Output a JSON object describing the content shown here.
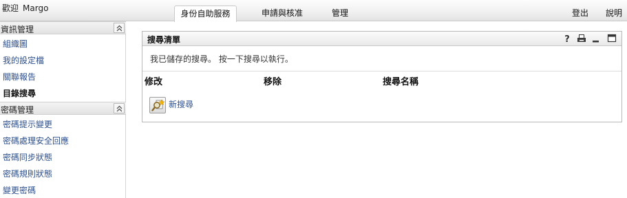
{
  "header": {
    "welcome_label": "歡迎",
    "user_name": "Margo",
    "tabs": [
      {
        "label": "身份自助服務",
        "active": true
      },
      {
        "label": "申請與核准",
        "active": false
      },
      {
        "label": "管理",
        "active": false
      }
    ],
    "logout_label": "登出",
    "help_label": "說明"
  },
  "sidebar": {
    "sections": [
      {
        "title": "資訊管理",
        "items": [
          {
            "label": "組織圖"
          },
          {
            "label": "我的設定檔"
          },
          {
            "label": "關聯報告"
          },
          {
            "label": "目錄搜尋",
            "current": true
          }
        ]
      },
      {
        "title": "密碼管理",
        "items": [
          {
            "label": "密碼提示變更"
          },
          {
            "label": "密碼處理安全回應"
          },
          {
            "label": "密碼同步狀態"
          },
          {
            "label": "密碼規則狀態"
          },
          {
            "label": "變更密碼"
          }
        ]
      }
    ]
  },
  "panel": {
    "title": "搜尋清單",
    "description": "我已儲存的搜尋。  按一下搜尋以執行。",
    "columns": [
      "修改",
      "移除",
      "搜尋名稱"
    ],
    "new_search_label": "新搜尋",
    "controls": [
      "help-icon",
      "print-icon",
      "minimize-icon",
      "maximize-icon"
    ]
  },
  "colors": {
    "link": "#2d4f8d",
    "header_bg": "#f1f1f1",
    "border": "#c9c9c9"
  }
}
